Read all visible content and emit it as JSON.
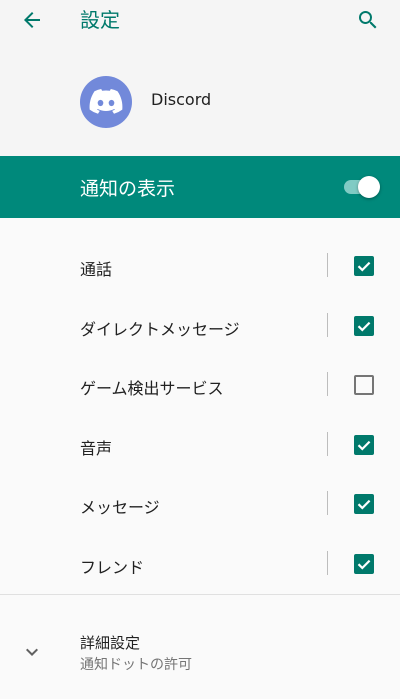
{
  "topbar": {
    "title": "設定",
    "back_icon": "arrow-left-icon",
    "search_icon": "search-icon"
  },
  "app": {
    "name": "Discord",
    "icon": "discord-logo-icon",
    "icon_color": "#7289da"
  },
  "master_toggle": {
    "label": "通知の表示",
    "enabled": true,
    "color": "#00897b"
  },
  "categories": [
    {
      "label": "通話",
      "checked": true
    },
    {
      "label": "ダイレクトメッセージ",
      "checked": true
    },
    {
      "label": "ゲーム検出サービス",
      "checked": false
    },
    {
      "label": "音声",
      "checked": true
    },
    {
      "label": "メッセージ",
      "checked": true
    },
    {
      "label": "フレンド",
      "checked": true
    }
  ],
  "advanced": {
    "title": "詳細設定",
    "subtitle": "通知ドットの許可",
    "icon": "chevron-down-icon"
  },
  "colors": {
    "accent": "#00796b",
    "text": "#212121",
    "secondary_text": "#757575"
  }
}
